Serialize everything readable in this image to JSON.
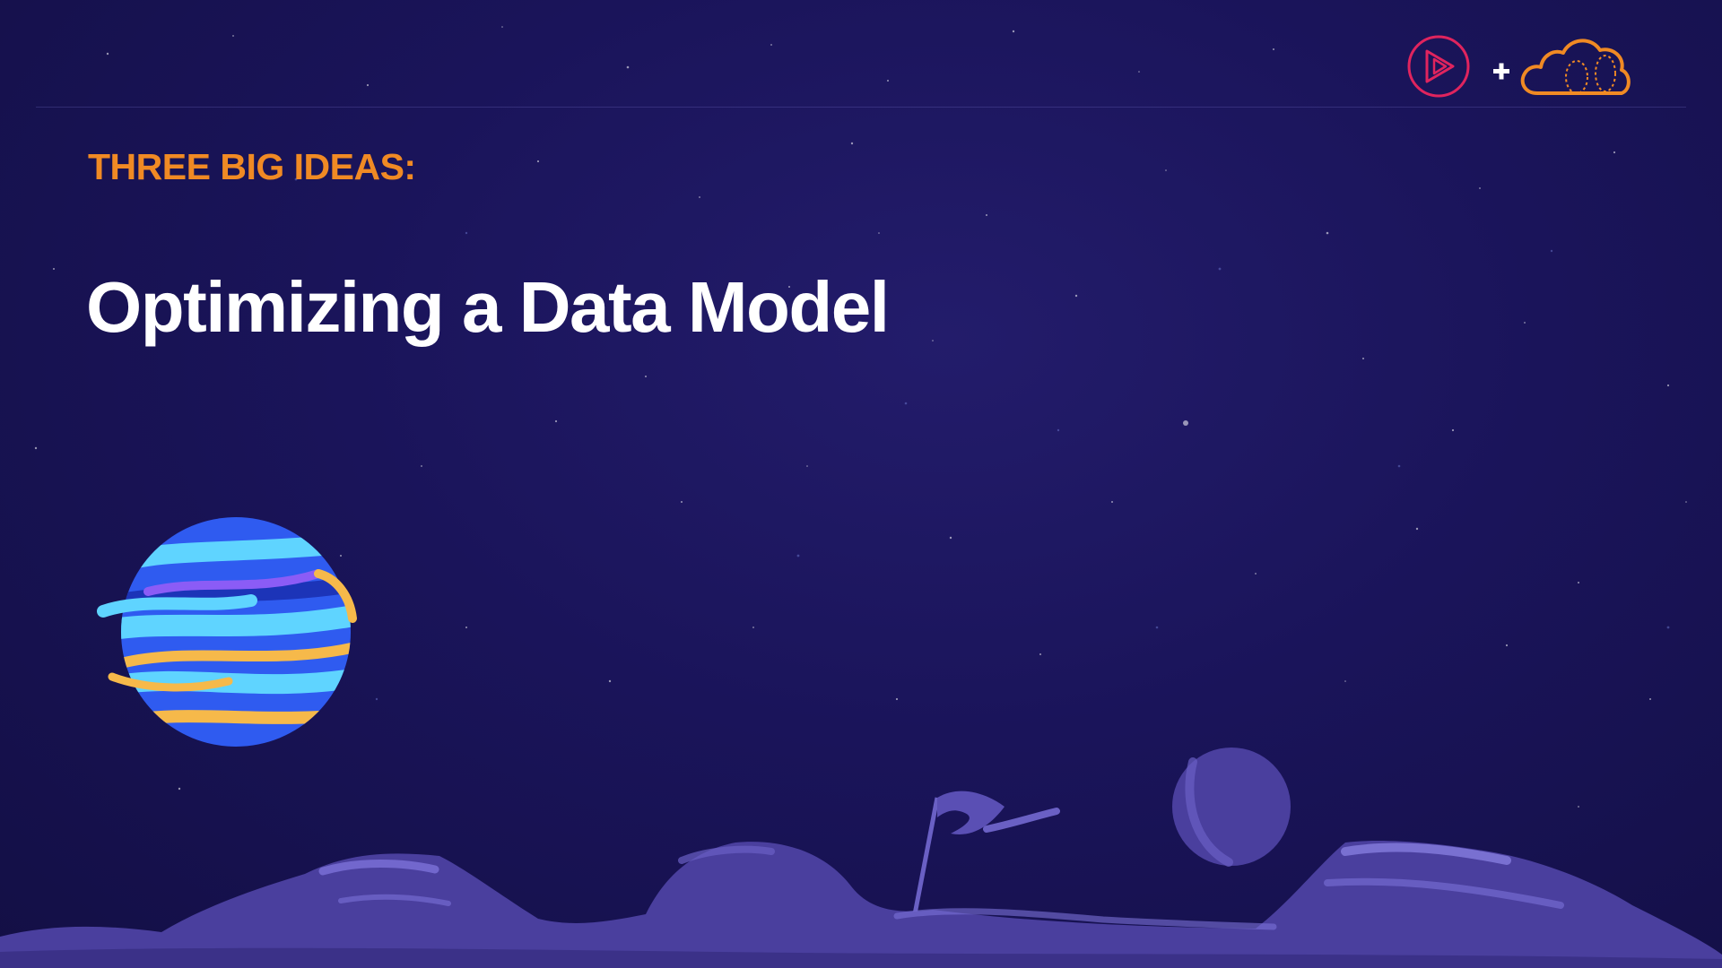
{
  "slide": {
    "eyebrow": "THREE BIG IDEAS:",
    "title": "Optimizing a Data Model"
  },
  "logos": {
    "left_icon": "play-circle-icon",
    "separator_icon": "plus-icon",
    "right_icon": "cloud-icon"
  },
  "colors": {
    "background": "#1a145a",
    "eyebrow": "#f08a24",
    "title": "#ffffff",
    "play_logo": "#e0245e",
    "cloud_logo": "#f08a24",
    "terrain": "#4a3f9e",
    "planet_blue": "#2f5bf0",
    "planet_cyan": "#5fd4ff",
    "planet_gold": "#f6b94a"
  }
}
